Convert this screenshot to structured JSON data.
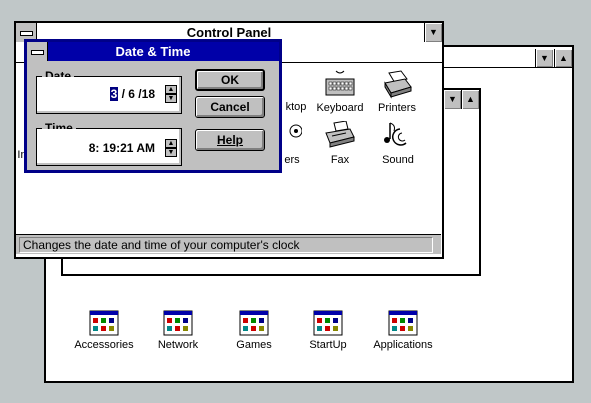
{
  "control_panel": {
    "title": "Control Panel",
    "status_text": "Changes the date and time of your computer's clock",
    "icons": {
      "desktop": "ktop",
      "keyboard": "Keyboard",
      "printers": "Printers",
      "int": "In",
      "drivers": "ers",
      "fax": "Fax",
      "sound": "Sound"
    }
  },
  "program_manager": {
    "groups": [
      "Accessories",
      "Network",
      "Games",
      "StartUp",
      "Applications"
    ]
  },
  "dialog": {
    "title": "Date & Time",
    "date_label": "Date",
    "date_value_month": "3",
    "date_value_rest": " / 6 /18",
    "time_label": "Time",
    "time_value": "8: 19:21 AM",
    "ok_label": "OK",
    "cancel_label": "Cancel",
    "help_label": "Help"
  }
}
